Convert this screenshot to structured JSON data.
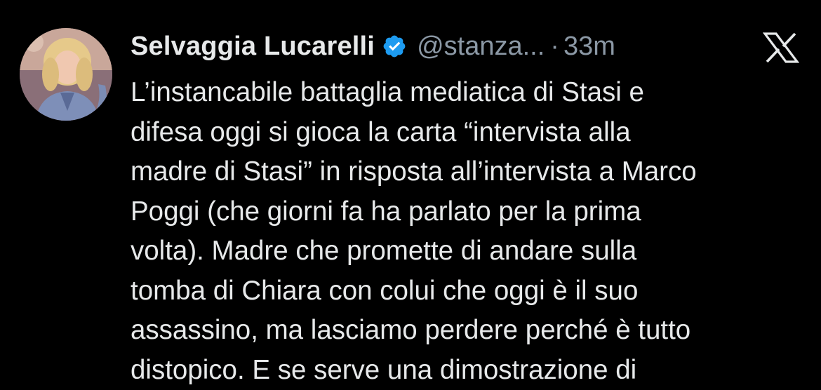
{
  "tweet": {
    "author_name": "Selvaggia Lucarelli",
    "handle": "@stanza...",
    "separator": "·",
    "timestamp": "33m",
    "verified_icon": "verified-badge-icon",
    "platform_icon": "x-logo-icon",
    "text_lines": [
      "L’instancabile battaglia mediatica di Stasi e",
      "difesa oggi si gioca la carta “intervista alla",
      "madre di Stasi” in risposta all’intervista a Marco",
      "Poggi (che giorni fa ha parlato per la prima",
      "volta). Madre che promette di andare sulla",
      "tomba di Chiara con colui che oggi è il suo",
      "assassino, ma lasciamo perdere perché è tutto",
      "distopico. E se serve una dimostrazione di"
    ]
  },
  "colors": {
    "background": "#000000",
    "primary_text": "#e7e9ea",
    "secondary_text": "#8b98a5",
    "verified": "#1d9bf0"
  }
}
